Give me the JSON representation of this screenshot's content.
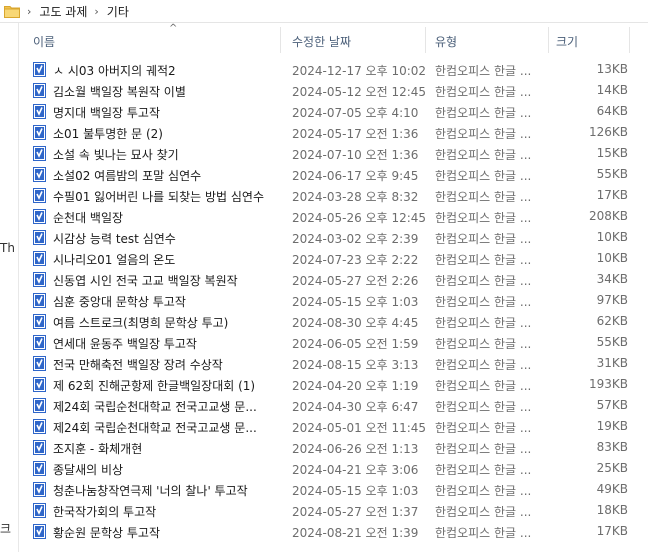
{
  "breadcrumb": [
    "고도 과제",
    "기타"
  ],
  "left_pane_fragments": [
    "Th",
    "크"
  ],
  "columns": {
    "name": "이름",
    "modified": "수정한 날짜",
    "type": "유형",
    "size": "크기",
    "sort_indicator": "^"
  },
  "files": [
    {
      "name": "ㅅ 시03 아버지의 궤적2",
      "modified": "2024-12-17 오후 10:02",
      "type": "한컴오피스 한글 ...",
      "size": "13KB"
    },
    {
      "name": "김소월 백일장 복원작 이별",
      "modified": "2024-05-12 오전 12:45",
      "type": "한컴오피스 한글 ...",
      "size": "14KB"
    },
    {
      "name": "명지대 백일장 투고작",
      "modified": "2024-07-05 오후 4:10",
      "type": "한컴오피스 한글 ...",
      "size": "64KB"
    },
    {
      "name": "소01 불투명한 문 (2)",
      "modified": "2024-05-17 오전 1:36",
      "type": "한컴오피스 한글 ...",
      "size": "126KB"
    },
    {
      "name": "소설 속 빛나는 묘사 찾기",
      "modified": "2024-07-10 오전 1:36",
      "type": "한컴오피스 한글 ...",
      "size": "15KB"
    },
    {
      "name": "소설02 여름밤의 포말 심연수",
      "modified": "2024-06-17 오후 9:45",
      "type": "한컴오피스 한글 ...",
      "size": "55KB"
    },
    {
      "name": "수필01 잃어버린 나를 되찾는 방법 심연수",
      "modified": "2024-03-28 오후 8:32",
      "type": "한컴오피스 한글 ...",
      "size": "17KB"
    },
    {
      "name": "순천대 백일장",
      "modified": "2024-05-26 오후 12:45",
      "type": "한컴오피스 한글 ...",
      "size": "208KB"
    },
    {
      "name": "시감상 능력 test 심연수",
      "modified": "2024-03-02 오후 2:39",
      "type": "한컴오피스 한글 ...",
      "size": "10KB"
    },
    {
      "name": "시나리오01 얼음의 온도",
      "modified": "2024-07-23 오후 2:22",
      "type": "한컴오피스 한글 ...",
      "size": "10KB"
    },
    {
      "name": "신동엽 시인 전국 고교 백일장 복원작",
      "modified": "2024-05-27 오전 2:26",
      "type": "한컴오피스 한글 ...",
      "size": "34KB"
    },
    {
      "name": "심훈 중앙대 문학상 투고작",
      "modified": "2024-05-15 오후 1:03",
      "type": "한컴오피스 한글 ...",
      "size": "97KB"
    },
    {
      "name": "여름 스트로크(최명희 문학상 투고)",
      "modified": "2024-08-30 오후 4:45",
      "type": "한컴오피스 한글 ...",
      "size": "62KB"
    },
    {
      "name": "연세대 윤동주 백일장 투고작",
      "modified": "2024-06-05 오전 1:59",
      "type": "한컴오피스 한글 ...",
      "size": "55KB"
    },
    {
      "name": "전국 만해축전 백일장 장려 수상작",
      "modified": "2024-08-15 오후 3:13",
      "type": "한컴오피스 한글 ...",
      "size": "31KB"
    },
    {
      "name": "제 62회 진해군항제 한글백일장대회 (1)",
      "modified": "2024-04-20 오후 1:19",
      "type": "한컴오피스 한글 ...",
      "size": "193KB"
    },
    {
      "name": "제24회 국립순천대학교 전국고교생 문...",
      "modified": "2024-04-30 오후 6:47",
      "type": "한컴오피스 한글 ...",
      "size": "57KB"
    },
    {
      "name": "제24회 국립순천대학교 전국고교생 문...",
      "modified": "2024-05-01 오전 11:45",
      "type": "한컴오피스 한글 ...",
      "size": "19KB"
    },
    {
      "name": "조지훈 - 화체개현",
      "modified": "2024-06-26 오전 1:13",
      "type": "한컴오피스 한글 ...",
      "size": "83KB"
    },
    {
      "name": "종달새의 비상",
      "modified": "2024-04-21 오후 3:06",
      "type": "한컴오피스 한글 ...",
      "size": "25KB"
    },
    {
      "name": "청춘나눔창작연극제 '너의 찰나' 투고작",
      "modified": "2024-05-15 오후 1:03",
      "type": "한컴오피스 한글 ...",
      "size": "49KB"
    },
    {
      "name": "한국작가회의 투고작",
      "modified": "2024-05-27 오전 1:37",
      "type": "한컴오피스 한글 ...",
      "size": "18KB"
    },
    {
      "name": "황순원 문학상 투고작",
      "modified": "2024-08-21 오전 1:39",
      "type": "한컴오피스 한글 ...",
      "size": "17KB"
    }
  ],
  "colors": {
    "header_text": "#4c607a",
    "secondary_text": "#6d6d6d",
    "hwp_icon_blue": "#2f66c9",
    "folder_yellow": "#f1c34f"
  }
}
